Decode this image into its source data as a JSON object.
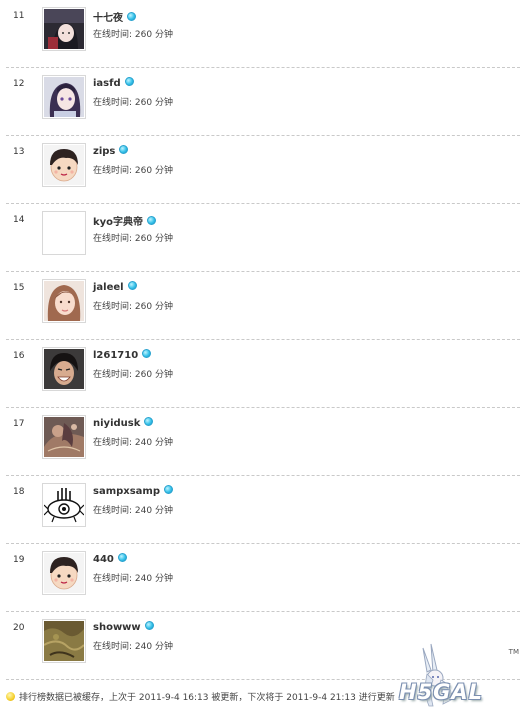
{
  "online_label": "在线时间: ",
  "users": [
    {
      "rank": "11",
      "name": "十七夜",
      "time": "260 分钟",
      "avatar_icon": "anime-girl-dark-avatar"
    },
    {
      "rank": "12",
      "name": "iasfd",
      "time": "260 分钟",
      "avatar_icon": "anime-girl-purple-hair-avatar"
    },
    {
      "rank": "13",
      "name": "zips",
      "time": "260 分钟",
      "avatar_icon": "default-cartoon-boy-avatar"
    },
    {
      "rank": "14",
      "name": "kyo字典帝",
      "time": "260 分钟",
      "avatar_icon": "blank-avatar"
    },
    {
      "rank": "15",
      "name": "jaleel",
      "time": "260 分钟",
      "avatar_icon": "photo-girl-avatar"
    },
    {
      "rank": "16",
      "name": "l261710",
      "time": "260 分钟",
      "avatar_icon": "photo-man-laughing-avatar"
    },
    {
      "rank": "17",
      "name": "niyidusk",
      "time": "240 分钟",
      "avatar_icon": "fantasy-art-avatar"
    },
    {
      "rank": "18",
      "name": "sampxsamp",
      "time": "240 分钟",
      "avatar_icon": "hand-eye-drawing-avatar"
    },
    {
      "rank": "19",
      "name": "440",
      "time": "240 分钟",
      "avatar_icon": "default-cartoon-boy-avatar"
    },
    {
      "rank": "20",
      "name": "showww",
      "time": "240 分钟",
      "avatar_icon": "dark-texture-avatar"
    }
  ],
  "footer": {
    "icon": "lightbulb-icon",
    "text": "排行榜数据已被缓存，上次于 2011-9-4 16:13 被更新，下次将于 2011-9-4 21:13 进行更新"
  },
  "watermark": {
    "text": "H5GAL",
    "tm": "TM"
  },
  "colors": {
    "online_dot": "#37c3ea",
    "divider": "#c9c9c9",
    "text": "#333333"
  }
}
